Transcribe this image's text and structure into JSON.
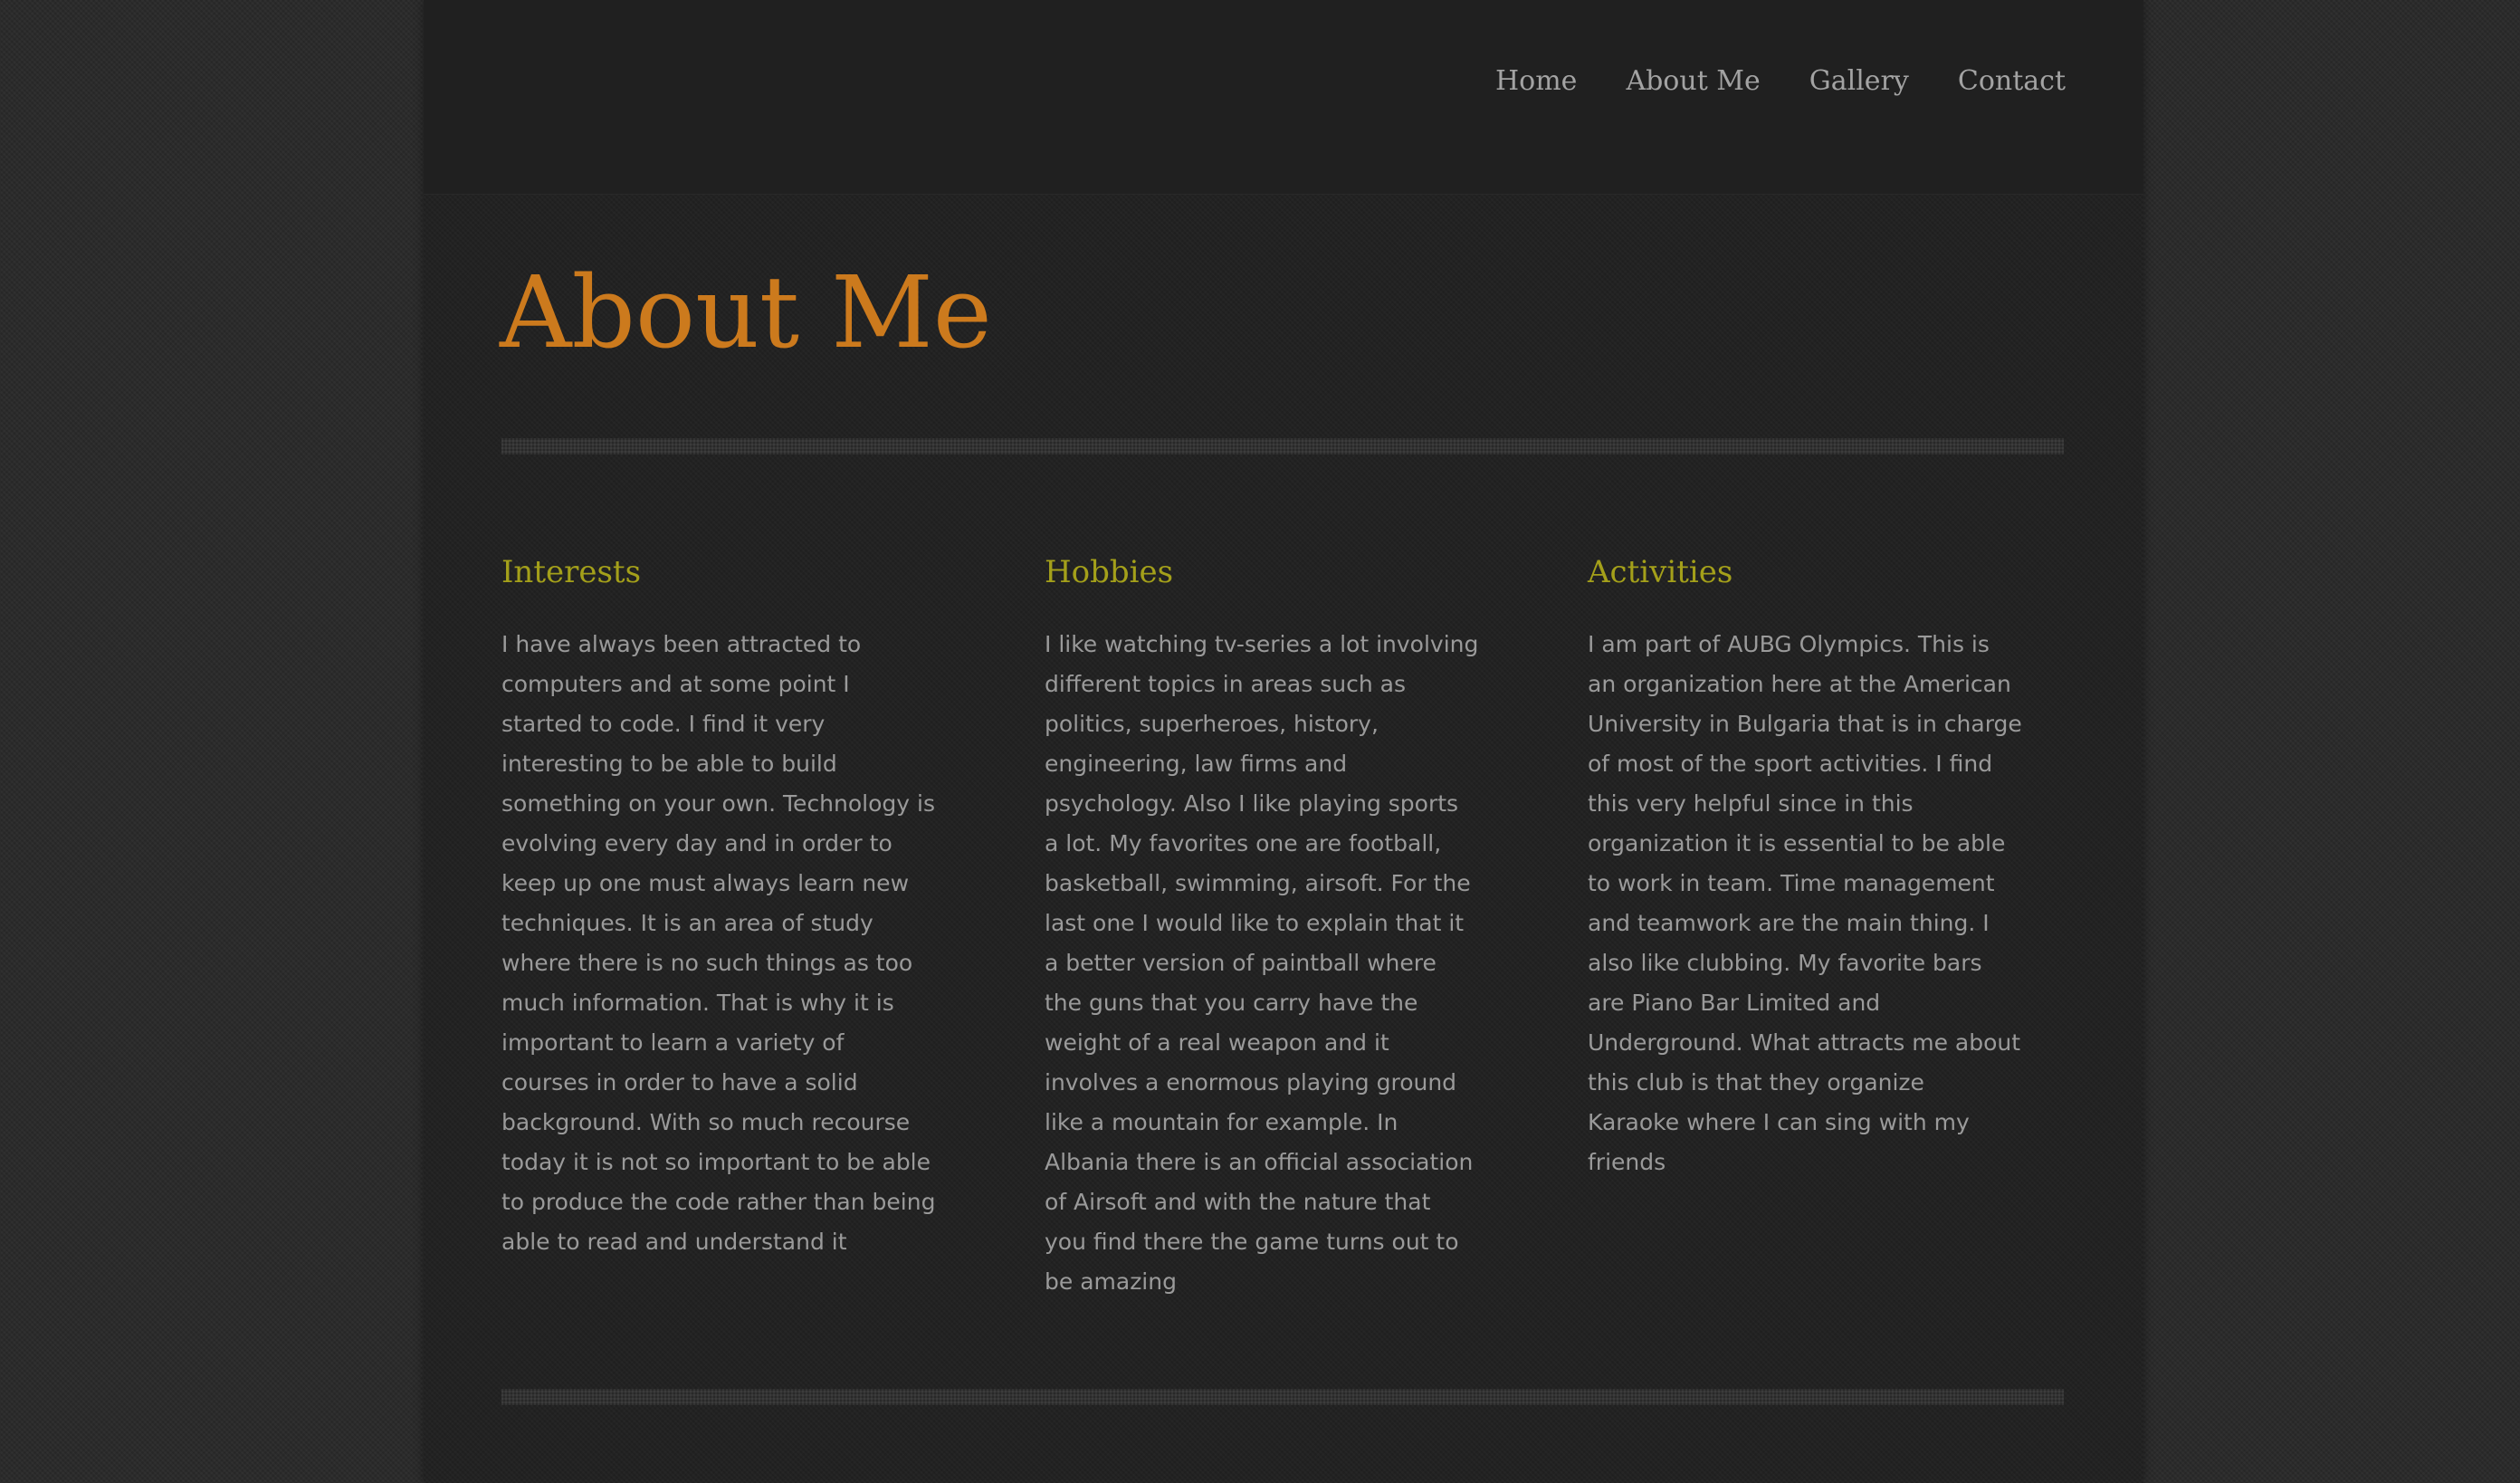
{
  "nav": {
    "items": [
      {
        "label": "Home"
      },
      {
        "label": "About Me"
      },
      {
        "label": "Gallery"
      },
      {
        "label": "Contact"
      }
    ]
  },
  "page": {
    "title": "About Me"
  },
  "columns": [
    {
      "heading": "Interests",
      "text": "I have always been attracted to computers and at some point I started to code. I find it very interesting to be able to build something on your own. Technology is evolving every day and in order to keep up one must always learn new techniques. It is an area of study where there is no such things as too much information. That is why it is important to learn a variety of courses in order to have a solid background. With so much recourse today it is not so important to be able to produce the code rather than being able to read and understand it"
    },
    {
      "heading": "Hobbies",
      "text": "I like watching tv-series a lot involving different topics in areas such as politics, superheroes, history, engineering, law firms and psychology. Also I like playing sports a lot. My favorites one are football, basketball, swimming, airsoft. For the last one I would like to explain that it a better version of paintball where the guns that you carry have the weight of a real weapon and it involves a enormous playing ground like a mountain for example. In Albania there is an official association of Airsoft and with the nature that you find there the game turns out to be amazing"
    },
    {
      "heading": "Activities",
      "text": "I am part of AUBG Olympics. This is an organization here at the American University in Bulgaria that is in charge of most of the sport activities. I find this very helpful since in this organization it is essential to be able to work in team. Time management and teamwork are the main thing. I also like clubbing. My favorite bars are Piano Bar Limited and Underground. What attracts me about this club is that they organize Karaoke where I can sing with my friends"
    }
  ],
  "colors": {
    "title": "#cc7a1d",
    "heading": "#a4a01a",
    "body_text": "#9a9a9a",
    "nav_text": "#a3a3a3",
    "page_background": "#2b2b2b",
    "container_background": "#222222"
  }
}
